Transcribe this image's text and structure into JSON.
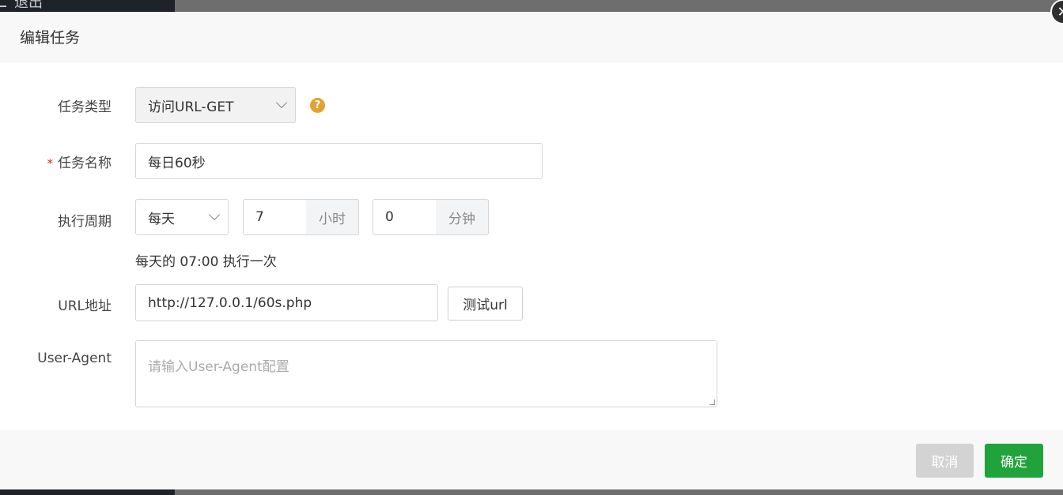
{
  "background": {
    "logout_label": "退出"
  },
  "modal": {
    "title": "编辑任务",
    "close_icon": "close-icon"
  },
  "form": {
    "task_type": {
      "label": "任务类型",
      "value": "访问URL-GET",
      "help": "?"
    },
    "task_name": {
      "label": "任务名称",
      "required_mark": "*",
      "value": "每日60秒"
    },
    "schedule": {
      "label": "执行周期",
      "period": "每天",
      "hour": "7",
      "hour_unit": "小时",
      "minute": "0",
      "minute_unit": "分钟",
      "summary": "每天的 07:00 执行一次"
    },
    "url": {
      "label": "URL地址",
      "value": "http://127.0.0.1/60s.php",
      "test_button": "测试url"
    },
    "user_agent": {
      "label": "User-Agent",
      "placeholder": "请输入User-Agent配置"
    }
  },
  "footer": {
    "cancel_label": "取消",
    "confirm_label": "确定"
  },
  "colors": {
    "confirm": "#21a33b",
    "help": "#e0a233",
    "required": "#e0242b"
  }
}
